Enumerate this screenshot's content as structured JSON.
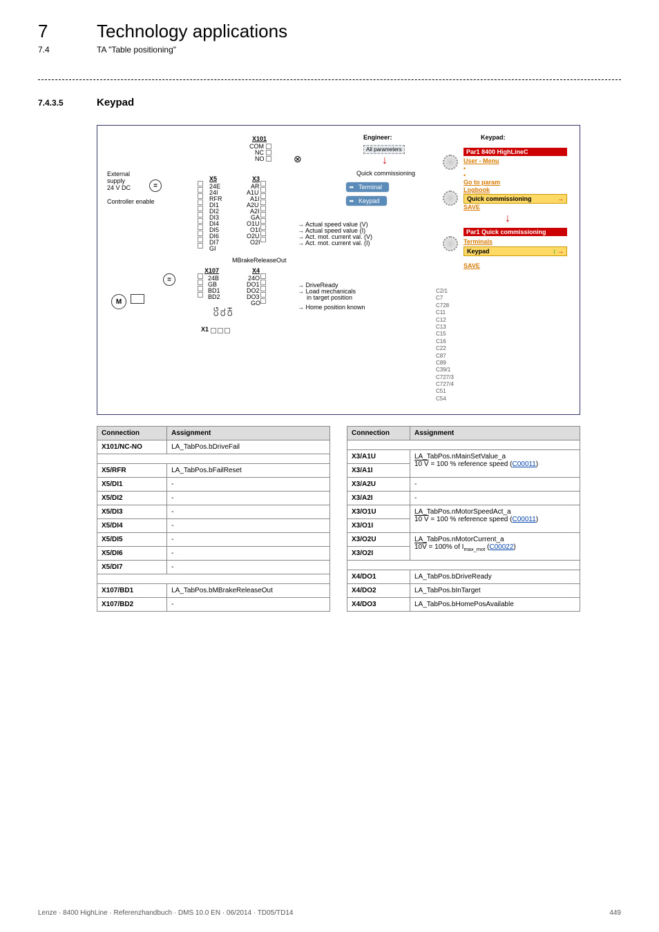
{
  "chapter": {
    "num": "7",
    "title": "Technology applications"
  },
  "section_line": {
    "num": "7.4",
    "title": "TA \"Table positioning\""
  },
  "section": {
    "num": "7.4.3.5",
    "title": "Keypad"
  },
  "diagram": {
    "engineer_label": "Engineer:",
    "keypad_label": "Keypad:",
    "all_params": "All parameters",
    "quick": "Quick commissioning",
    "terminal_pill": "Terminal",
    "keypad_pill": "Keypad",
    "kp_title": "Par1 8400 HighLineC",
    "kp_user_menu": "User - Menu",
    "kp_goto": "Go to param",
    "kp_logbook": "Logbook",
    "kp_quick": "Quick commissioning",
    "kp_save": "SAVE",
    "kp_par1_quick": "Par1 Quick commissioning",
    "kp_terminals": "Terminals",
    "kp_keypad": "Keypad",
    "external_supply": "External\nsupply\n24 V DC",
    "controller_enable": "Controller enable",
    "x101": "X101",
    "x101_com": "COM",
    "x101_nc": "NC",
    "x101_no": "NO",
    "x5": "X5",
    "x5_24e": "24E",
    "x5_24i": "24I",
    "x5_rfr": "RFR",
    "x5_di1": "DI1",
    "x5_di2": "DI2",
    "x5_di3": "DI3",
    "x5_di4": "DI4",
    "x5_di5": "DI5",
    "x5_di6": "DI6",
    "x5_di7": "DI7",
    "x5_gi": "GI",
    "x3": "X3",
    "x3_ar": "AR",
    "x3_a1u": "A1U",
    "x3_a1i": "A1I",
    "x3_a2u": "A2U",
    "x3_a2i": "A2I",
    "x3_ga": "GA",
    "x3_o1u": "O1U",
    "x3_o1i": "O1I",
    "x3_o2u": "O2U",
    "x3_o2i": "O2I",
    "mbrake": "MBrakeReleaseOut",
    "x107": "X107",
    "x107_24b": "24B",
    "x107_gb": "GB",
    "x107_bd1": "BD1",
    "x107_bd2": "BD2",
    "x4": "X4",
    "x4_24o": "24O",
    "x4_do1": "DO1",
    "x4_do2": "DO2",
    "x4_do3": "DO3",
    "x4_go": "GO",
    "x1": "X1",
    "x1_cg": "CG",
    "x1_cl": "CL",
    "x1_ch": "CH",
    "sig1": "Actual speed value (V)",
    "sig2": "Actual speed value (I)",
    "sig3": "Act. mot. current val. (V)",
    "sig4": "Act. mot. current val. (I)",
    "sig5": "DriveReady",
    "sig6": "Load mechanicals",
    "sig7": "in target position",
    "sig8": "Home position known",
    "codes": [
      "C2/1",
      "C7",
      "C728",
      "C11",
      "C12",
      "C13",
      "C15",
      "C16",
      "C22",
      "C87",
      "C89",
      "C39/1",
      "C727/3",
      "C727/4",
      "C51",
      "C54"
    ]
  },
  "tables": {
    "left_header": {
      "c1": "Connection",
      "c2": "Assignment"
    },
    "left_rows": [
      {
        "c1": "X101/NC-NO",
        "c2": "LA_TabPos.bDriveFail"
      },
      {
        "spacer": true
      },
      {
        "c1": "X5/RFR",
        "c2": "LA_TabPos.bFailReset"
      },
      {
        "c1": "X5/DI1",
        "c2": "-"
      },
      {
        "c1": "X5/DI2",
        "c2": "-"
      },
      {
        "c1": "X5/DI3",
        "c2": "-"
      },
      {
        "c1": "X5/DI4",
        "c2": "-"
      },
      {
        "c1": "X5/DI5",
        "c2": "-"
      },
      {
        "c1": "X5/DI6",
        "c2": "-"
      },
      {
        "c1": "X5/DI7",
        "c2": "-"
      },
      {
        "spacer": true
      },
      {
        "c1": "X107/BD1",
        "c2": "LA_TabPos.bMBrakeReleaseOut"
      },
      {
        "c1": "X107/BD2",
        "c2": "-"
      }
    ],
    "right_header": {
      "c1": "Connection",
      "c2": "Assignment"
    },
    "right_rows": [
      {
        "spacer": true
      },
      {
        "c1": "X3/A1U",
        "c2_pre": "LA_TabPos.nMainSetValue_a",
        "rowspan": 2
      },
      {
        "c1": "X3/A1I",
        "merge": true,
        "c2_complex_10v": true,
        "link": "C00011"
      },
      {
        "c1": "X3/A2U",
        "c2": "-"
      },
      {
        "c1": "X3/A2I",
        "c2": "-"
      },
      {
        "c1": "X3/O1U",
        "c2_pre": "LA_TabPos.nMotorSpeedAct_a",
        "rowspan": 2
      },
      {
        "c1": "X3/O1I",
        "merge": true,
        "c2_complex_10v": true,
        "link": "C00011"
      },
      {
        "c1": "X3/O2U",
        "c2_pre": "LA_TabPos.nMotorCurrent_a",
        "rowspan": 2
      },
      {
        "c1": "X3/O2I",
        "merge": true,
        "c2_imax": true,
        "link": "C00022"
      },
      {
        "spacer": true
      },
      {
        "c1": "X4/DO1",
        "c2": "LA_TabPos.bDriveReady"
      },
      {
        "c1": "X4/DO2",
        "c2": "LA_TabPos.bInTarget"
      },
      {
        "c1": "X4/DO3",
        "c2": "LA_TabPos.bHomePosAvailable"
      }
    ],
    "ref_speed_text": " = 100 % reference speed (",
    "imax_text_pre": " = 100% of I",
    "imax_sub": "max_mot",
    "imax_text_post": " (",
    "close_paren": ")",
    "ten_v": "10 V"
  },
  "footer": {
    "left": "Lenze · 8400 HighLine · Referenzhandbuch · DMS 10.0 EN · 06/2014 · TD05/TD14",
    "right": "449"
  }
}
